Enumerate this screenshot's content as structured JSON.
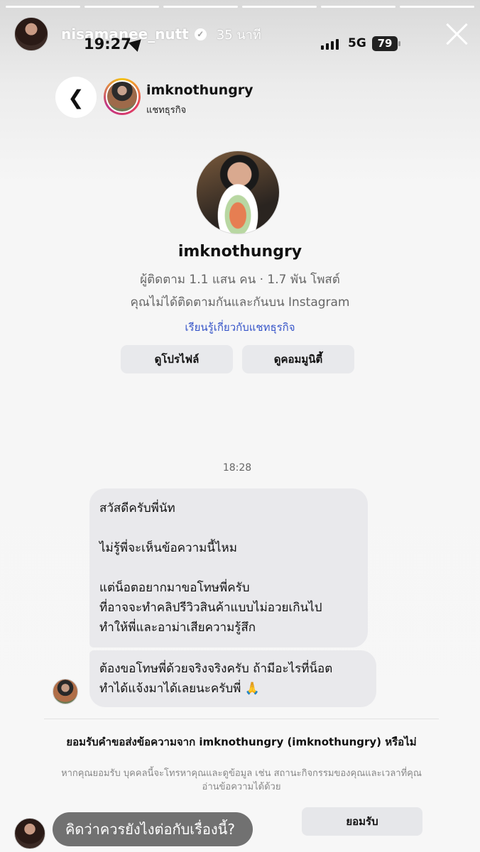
{
  "story": {
    "username": "nisamanee_nutt",
    "time_ago": "35 นาที",
    "reply_placeholder": "คิดว่าควรยังไงต่อกับเรื่องนี้?"
  },
  "status_bar": {
    "time": "19:27",
    "network": "5G",
    "battery": "79"
  },
  "chat_header": {
    "name": "imknothungry",
    "subtitle": "แชทธุรกิจ"
  },
  "profile": {
    "name": "imknothungry",
    "stats": "ผู้ติดตาม 1.1 แสน คน · 1.7 พัน โพสต์",
    "follow_note": "คุณไม่ได้ติดตามกันและกันบน Instagram",
    "learn_link": "เรียนรู้เกี่ยวกับแชทธุรกิจ",
    "view_profile": "ดูโปรไฟล์",
    "view_community": "ดูคอมมูนิตี้"
  },
  "messages": {
    "timestamp": "18:28",
    "bubble1": {
      "line1": "สวัสดีครับพี่นัท",
      "line2": "ไม่รู้พี่จะเห็นข้อความนี้ไหม",
      "line3": "แต่น็อตอยากมาขอโทษพี่ครับ",
      "line4": "ที่อาจจะทำคลิปรีวิวสินค้าแบบไม่อวยเกินไป",
      "line5": "ทำให้พี่และอาม่าเสียความรู้สึก"
    },
    "bubble2": {
      "line1": "ต้องขอโทษพี่ด้วยจริงจริงครับ ถ้ามีอะไรที่น็อต",
      "line2": "ทำได้แจ้งมาได้เลยนะครับพี่ 🙏"
    }
  },
  "request": {
    "title": "ยอมรับคำขอส่งข้อความจาก imknothungry (imknothungry) หรือไม่",
    "note": "หากคุณยอมรับ บุคคลนี้จะโทรหาคุณและดูข้อมูล เช่น สถานะกิจกรรมของคุณและเวลาที่คุณอ่านข้อความได้ด้วย",
    "accept": "ยอมรับ"
  }
}
